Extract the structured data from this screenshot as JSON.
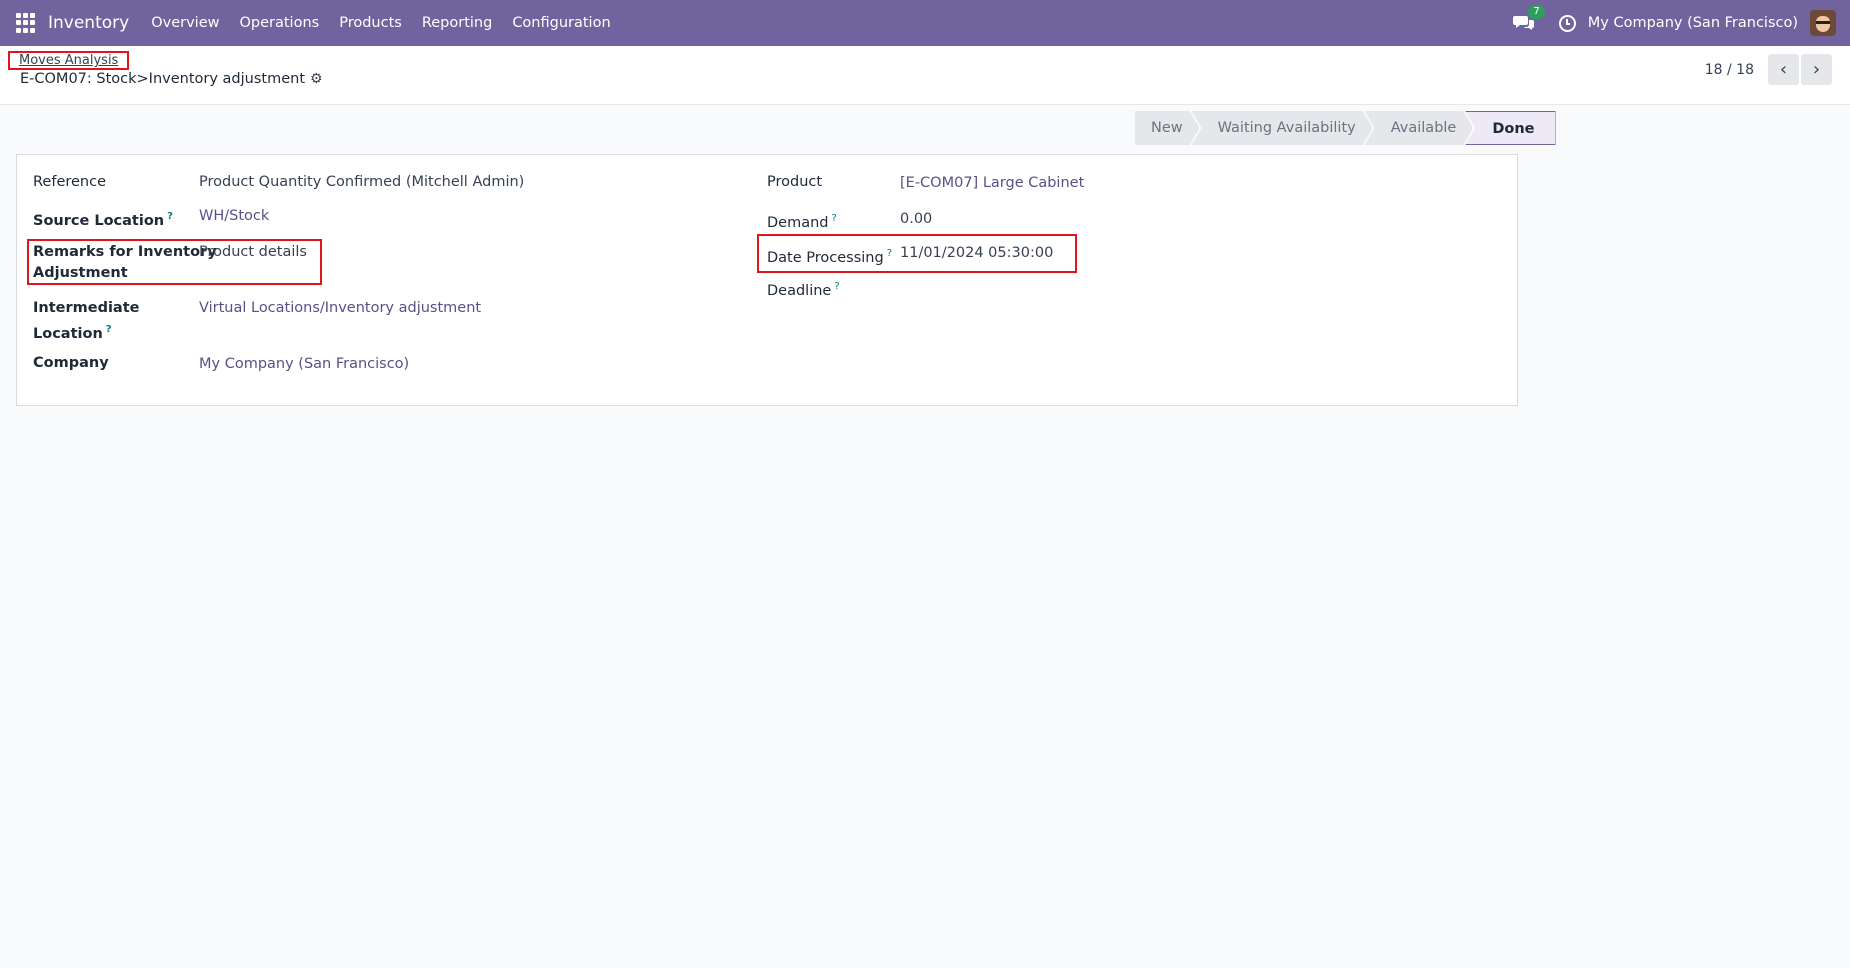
{
  "navbar": {
    "app_name": "Inventory",
    "menu": [
      "Overview",
      "Operations",
      "Products",
      "Reporting",
      "Configuration"
    ],
    "chat_count": "7",
    "company": "My Company (San Francisco)"
  },
  "breadcrumb": {
    "parent": "Moves Analysis",
    "current": "E-COM07: Stock>Inventory adjustment"
  },
  "pager": {
    "value": "18 / 18"
  },
  "status": {
    "stages": [
      "New",
      "Waiting Availability",
      "Available",
      "Done"
    ],
    "active": "Done"
  },
  "form": {
    "left": {
      "reference_label": "Reference",
      "reference_value": "Product Quantity Confirmed (Mitchell Admin)",
      "source_location_label": "Source Location",
      "source_location_value": "WH/Stock",
      "remarks_label_1": "Remarks for Inventory",
      "remarks_label_2": "Adjustment",
      "remarks_value": "Product details",
      "intermediate_label_1": "Intermediate",
      "intermediate_label_2": "Location",
      "intermediate_value": "Virtual Locations/Inventory adjustment",
      "company_label": "Company",
      "company_value": "My Company (San Francisco)"
    },
    "right": {
      "product_label": "Product",
      "product_value": "[E-COM07] Large Cabinet",
      "demand_label": "Demand",
      "demand_value": "0.00",
      "date_processing_label": "Date Processing",
      "date_processing_value": "11/01/2024 05:30:00",
      "deadline_label": "Deadline",
      "help_mark": "?"
    }
  },
  "colors": {
    "navbar": "#71639e",
    "highlight": "#e0141b",
    "link": "#5b4f89"
  }
}
